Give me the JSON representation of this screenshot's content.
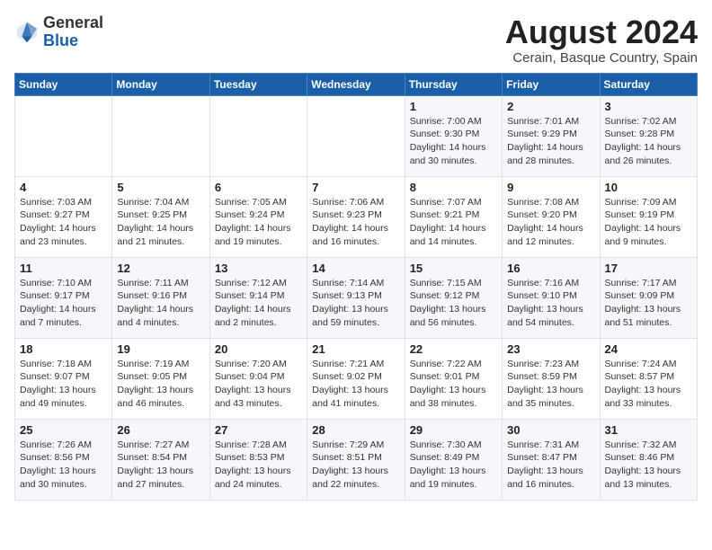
{
  "logo": {
    "general": "General",
    "blue": "Blue"
  },
  "title": "August 2024",
  "location": "Cerain, Basque Country, Spain",
  "days_of_week": [
    "Sunday",
    "Monday",
    "Tuesday",
    "Wednesday",
    "Thursday",
    "Friday",
    "Saturday"
  ],
  "weeks": [
    [
      {
        "day": "",
        "info": ""
      },
      {
        "day": "",
        "info": ""
      },
      {
        "day": "",
        "info": ""
      },
      {
        "day": "",
        "info": ""
      },
      {
        "day": "1",
        "info": "Sunrise: 7:00 AM\nSunset: 9:30 PM\nDaylight: 14 hours\nand 30 minutes."
      },
      {
        "day": "2",
        "info": "Sunrise: 7:01 AM\nSunset: 9:29 PM\nDaylight: 14 hours\nand 28 minutes."
      },
      {
        "day": "3",
        "info": "Sunrise: 7:02 AM\nSunset: 9:28 PM\nDaylight: 14 hours\nand 26 minutes."
      }
    ],
    [
      {
        "day": "4",
        "info": "Sunrise: 7:03 AM\nSunset: 9:27 PM\nDaylight: 14 hours\nand 23 minutes."
      },
      {
        "day": "5",
        "info": "Sunrise: 7:04 AM\nSunset: 9:25 PM\nDaylight: 14 hours\nand 21 minutes."
      },
      {
        "day": "6",
        "info": "Sunrise: 7:05 AM\nSunset: 9:24 PM\nDaylight: 14 hours\nand 19 minutes."
      },
      {
        "day": "7",
        "info": "Sunrise: 7:06 AM\nSunset: 9:23 PM\nDaylight: 14 hours\nand 16 minutes."
      },
      {
        "day": "8",
        "info": "Sunrise: 7:07 AM\nSunset: 9:21 PM\nDaylight: 14 hours\nand 14 minutes."
      },
      {
        "day": "9",
        "info": "Sunrise: 7:08 AM\nSunset: 9:20 PM\nDaylight: 14 hours\nand 12 minutes."
      },
      {
        "day": "10",
        "info": "Sunrise: 7:09 AM\nSunset: 9:19 PM\nDaylight: 14 hours\nand 9 minutes."
      }
    ],
    [
      {
        "day": "11",
        "info": "Sunrise: 7:10 AM\nSunset: 9:17 PM\nDaylight: 14 hours\nand 7 minutes."
      },
      {
        "day": "12",
        "info": "Sunrise: 7:11 AM\nSunset: 9:16 PM\nDaylight: 14 hours\nand 4 minutes."
      },
      {
        "day": "13",
        "info": "Sunrise: 7:12 AM\nSunset: 9:14 PM\nDaylight: 14 hours\nand 2 minutes."
      },
      {
        "day": "14",
        "info": "Sunrise: 7:14 AM\nSunset: 9:13 PM\nDaylight: 13 hours\nand 59 minutes."
      },
      {
        "day": "15",
        "info": "Sunrise: 7:15 AM\nSunset: 9:12 PM\nDaylight: 13 hours\nand 56 minutes."
      },
      {
        "day": "16",
        "info": "Sunrise: 7:16 AM\nSunset: 9:10 PM\nDaylight: 13 hours\nand 54 minutes."
      },
      {
        "day": "17",
        "info": "Sunrise: 7:17 AM\nSunset: 9:09 PM\nDaylight: 13 hours\nand 51 minutes."
      }
    ],
    [
      {
        "day": "18",
        "info": "Sunrise: 7:18 AM\nSunset: 9:07 PM\nDaylight: 13 hours\nand 49 minutes."
      },
      {
        "day": "19",
        "info": "Sunrise: 7:19 AM\nSunset: 9:05 PM\nDaylight: 13 hours\nand 46 minutes."
      },
      {
        "day": "20",
        "info": "Sunrise: 7:20 AM\nSunset: 9:04 PM\nDaylight: 13 hours\nand 43 minutes."
      },
      {
        "day": "21",
        "info": "Sunrise: 7:21 AM\nSunset: 9:02 PM\nDaylight: 13 hours\nand 41 minutes."
      },
      {
        "day": "22",
        "info": "Sunrise: 7:22 AM\nSunset: 9:01 PM\nDaylight: 13 hours\nand 38 minutes."
      },
      {
        "day": "23",
        "info": "Sunrise: 7:23 AM\nSunset: 8:59 PM\nDaylight: 13 hours\nand 35 minutes."
      },
      {
        "day": "24",
        "info": "Sunrise: 7:24 AM\nSunset: 8:57 PM\nDaylight: 13 hours\nand 33 minutes."
      }
    ],
    [
      {
        "day": "25",
        "info": "Sunrise: 7:26 AM\nSunset: 8:56 PM\nDaylight: 13 hours\nand 30 minutes."
      },
      {
        "day": "26",
        "info": "Sunrise: 7:27 AM\nSunset: 8:54 PM\nDaylight: 13 hours\nand 27 minutes."
      },
      {
        "day": "27",
        "info": "Sunrise: 7:28 AM\nSunset: 8:53 PM\nDaylight: 13 hours\nand 24 minutes."
      },
      {
        "day": "28",
        "info": "Sunrise: 7:29 AM\nSunset: 8:51 PM\nDaylight: 13 hours\nand 22 minutes."
      },
      {
        "day": "29",
        "info": "Sunrise: 7:30 AM\nSunset: 8:49 PM\nDaylight: 13 hours\nand 19 minutes."
      },
      {
        "day": "30",
        "info": "Sunrise: 7:31 AM\nSunset: 8:47 PM\nDaylight: 13 hours\nand 16 minutes."
      },
      {
        "day": "31",
        "info": "Sunrise: 7:32 AM\nSunset: 8:46 PM\nDaylight: 13 hours\nand 13 minutes."
      }
    ]
  ]
}
